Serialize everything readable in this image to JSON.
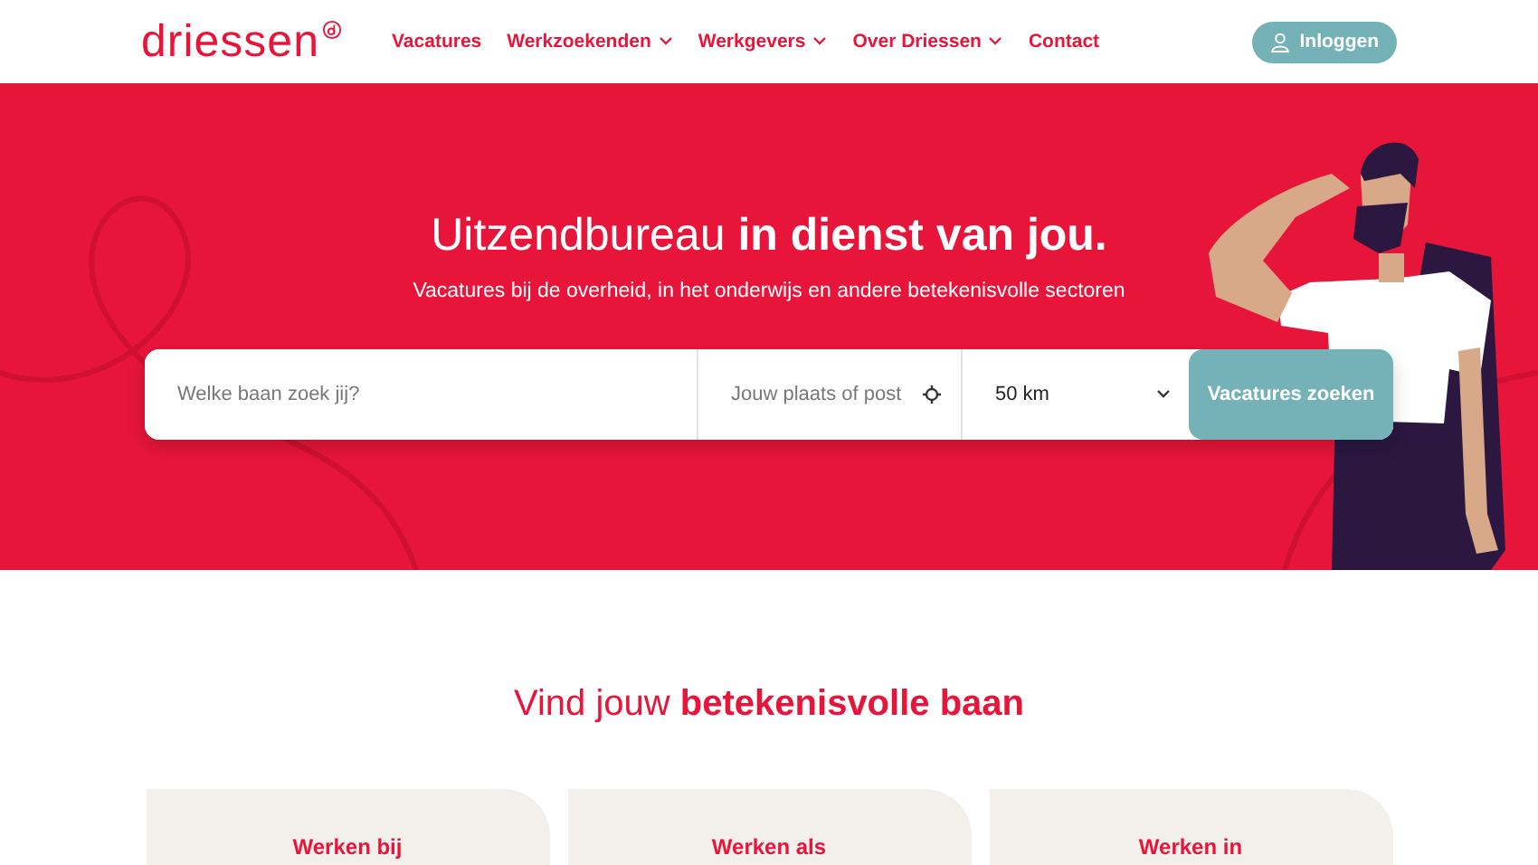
{
  "header": {
    "logo": "driessen",
    "nav": [
      {
        "label": "Vacatures",
        "dropdown": false
      },
      {
        "label": "Werkzoekenden",
        "dropdown": true
      },
      {
        "label": "Werkgevers",
        "dropdown": true
      },
      {
        "label": "Over Driessen",
        "dropdown": true
      },
      {
        "label": "Contact",
        "dropdown": false
      }
    ],
    "login_button": "Inloggen"
  },
  "hero": {
    "title": "Uitzendbureau **in dienst van jou.**",
    "subtitle": "Vacatures bij de overheid, in het onderwijs en andere betekenisvolle sectoren",
    "search": {
      "job_placeholder": "Welke baan zoek jij?",
      "location_placeholder": "Jouw plaats of post",
      "radius": "50 km",
      "button": "Vacatures zoeken"
    }
  },
  "section": {
    "heading": "Vind jouw **betekenisvolle baan**",
    "cards": [
      {
        "title": "Werken bij"
      },
      {
        "title": "Werken als"
      },
      {
        "title": "Werken in"
      }
    ]
  }
}
